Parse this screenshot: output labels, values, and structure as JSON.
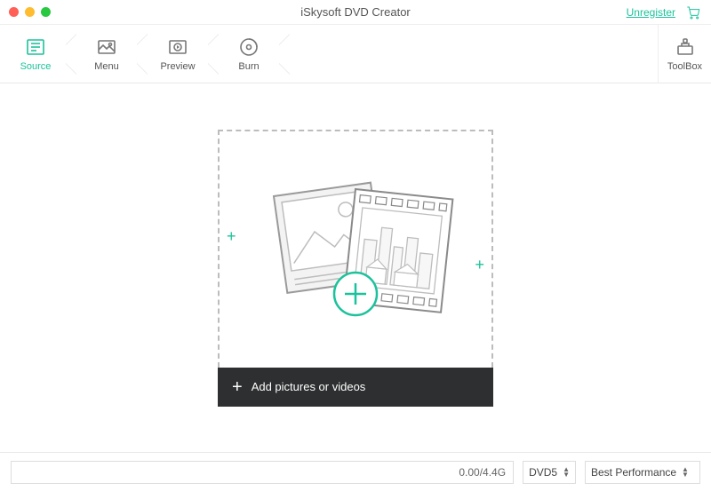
{
  "titlebar": {
    "title": "iSkysoft DVD Creator",
    "unregister": "Unregister"
  },
  "steps": {
    "source": "Source",
    "menu": "Menu",
    "preview": "Preview",
    "burn": "Burn",
    "toolbox": "ToolBox"
  },
  "dropzone": {
    "add_label": "Add pictures or videos"
  },
  "footer": {
    "progress": "0.00/4.4G",
    "disc_type": "DVD5",
    "quality": "Best Performance"
  },
  "colors": {
    "accent": "#1cc29b"
  }
}
